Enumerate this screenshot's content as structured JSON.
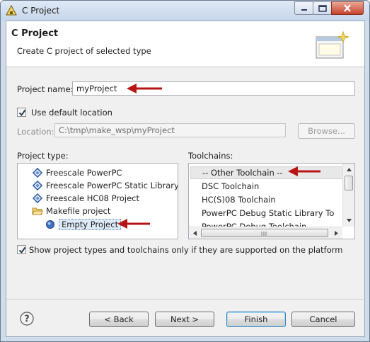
{
  "window": {
    "title": "C Project"
  },
  "header": {
    "title": "C Project",
    "description": "Create C project of selected type"
  },
  "project_name": {
    "label": "Project name:",
    "value": "myProject"
  },
  "use_default_location": {
    "label": "Use default location",
    "checked": true
  },
  "location": {
    "label": "Location:",
    "value": "C:\\tmp\\make_wsp\\myProject",
    "browse_label": "Browse..."
  },
  "project_type": {
    "label": "Project type:",
    "items": [
      {
        "label": "Freescale PowerPC",
        "icon": "diamond-icon"
      },
      {
        "label": "Freescale PowerPC Static Library",
        "icon": "diamond-icon"
      },
      {
        "label": "Freescale HC08 Project",
        "icon": "diamond-icon"
      },
      {
        "label": "Makefile project",
        "icon": "folder-open-icon"
      },
      {
        "label": "Empty Project",
        "icon": "circle-icon",
        "selected": true
      }
    ]
  },
  "toolchains": {
    "label": "Toolchains:",
    "items": [
      {
        "label": "-- Other Toolchain --",
        "selected": true
      },
      {
        "label": "DSC Toolchain"
      },
      {
        "label": "HC(S)08 Toolchain"
      },
      {
        "label": "PowerPC Debug Static Library Toolchain"
      },
      {
        "label": "PowerPC Debug Toolchain"
      }
    ]
  },
  "show_supported": {
    "label": "Show project types and toolchains only if they are supported on the platform",
    "checked": true
  },
  "buttons": {
    "back": "< Back",
    "next": "Next >",
    "finish": "Finish",
    "cancel": "Cancel"
  },
  "colors": {
    "annotation_arrow": "#b81414",
    "diamond": "#2f5ea8",
    "folder": "#e3b64a"
  }
}
